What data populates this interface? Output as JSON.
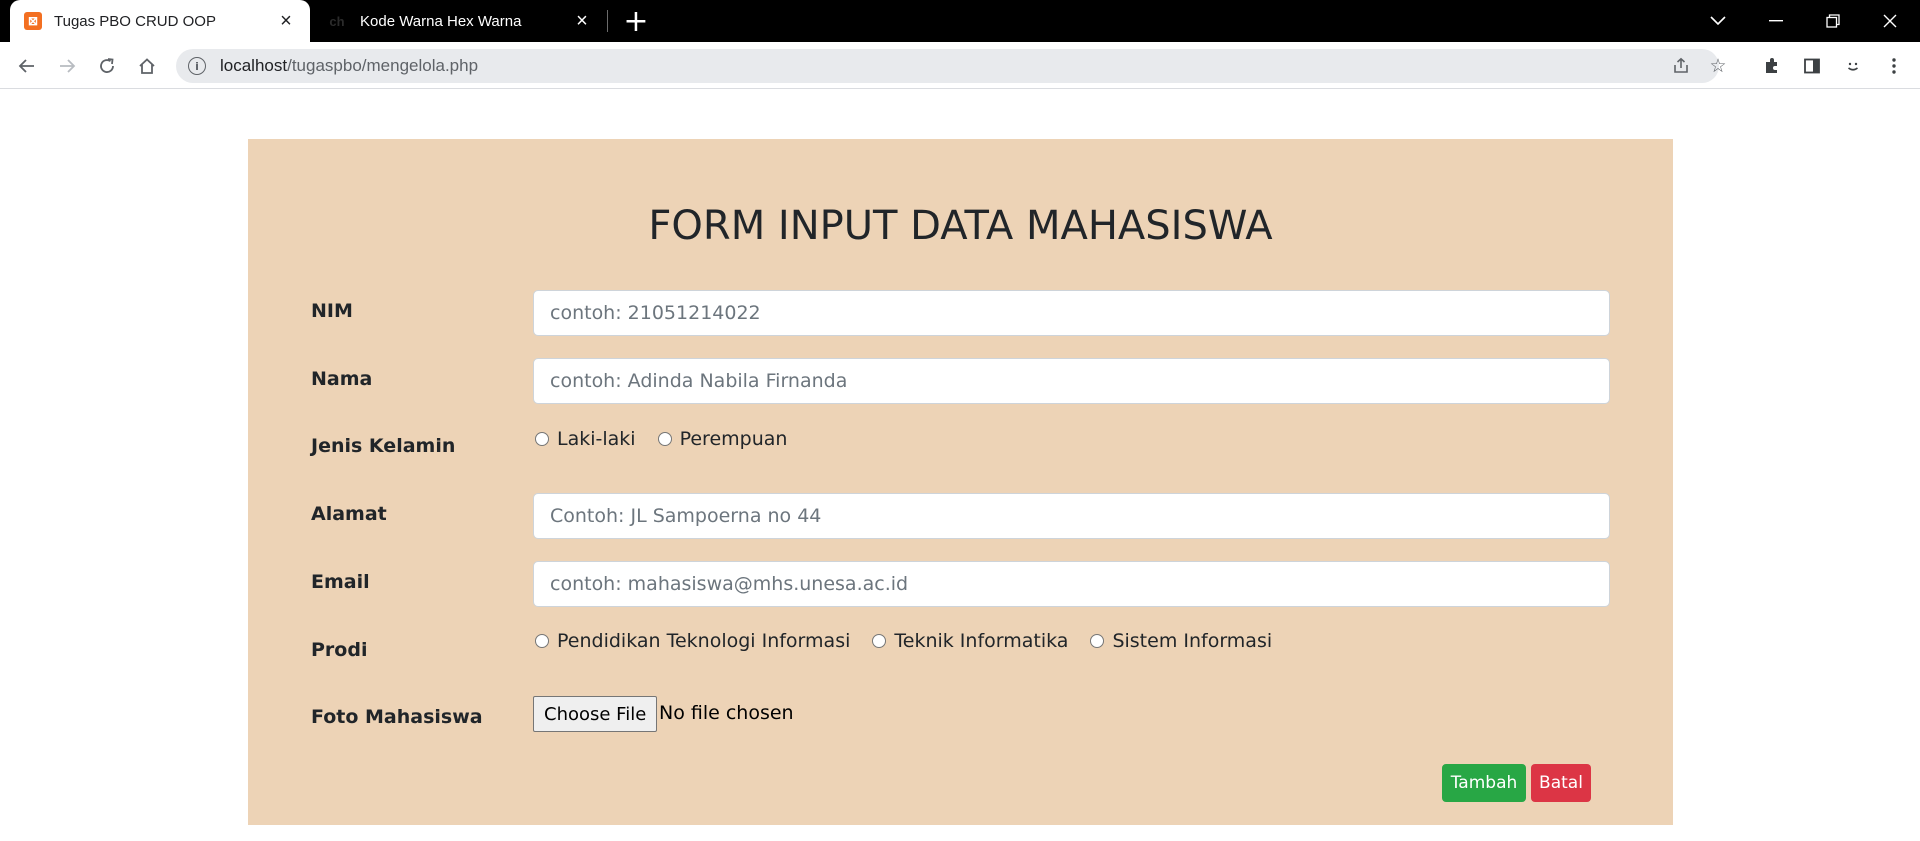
{
  "browser": {
    "tabs": [
      {
        "title": "Tugas PBO CRUD OOP",
        "active": true,
        "icon": "xampp-icon"
      },
      {
        "title": "Kode Warna Hex Warna",
        "active": false,
        "icon": "ch-favicon",
        "favicon_text": "ch"
      }
    ],
    "url_host": "localhost",
    "url_path": "/tugaspbo/mengelola.php"
  },
  "form": {
    "title": "FORM INPUT DATA MAHASISWA",
    "fields": {
      "nim": {
        "label": "NIM",
        "placeholder": "contoh: 21051214022"
      },
      "nama": {
        "label": "Nama",
        "placeholder": "contoh: Adinda Nabila Firnanda"
      },
      "jenis_kelamin": {
        "label": "Jenis Kelamin",
        "options": [
          "Laki-laki",
          "Perempuan"
        ]
      },
      "alamat": {
        "label": "Alamat",
        "placeholder": "Contoh: JL Sampoerna no 44"
      },
      "email": {
        "label": "Email",
        "placeholder": "contoh: mahasiswa@mhs.unesa.ac.id"
      },
      "prodi": {
        "label": "Prodi",
        "options": [
          "Pendidikan Teknologi Informasi",
          "Teknik Informatika",
          "Sistem Informasi"
        ]
      },
      "foto": {
        "label": "Foto Mahasiswa",
        "button": "Choose File",
        "status": "No file chosen"
      }
    },
    "buttons": {
      "submit": "Tambah",
      "cancel": "Batal"
    },
    "colors": {
      "card_bg": "#edd3b6",
      "success": "#28a745",
      "danger": "#dc3545"
    }
  }
}
